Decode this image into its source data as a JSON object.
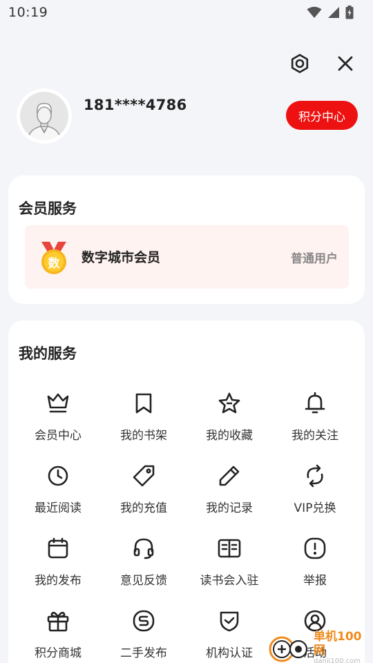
{
  "status_bar": {
    "time": "10:19"
  },
  "profile": {
    "phone": "181****4786",
    "points_button": "积分中心"
  },
  "member_card": {
    "title": "会员服务",
    "medal_char": "数",
    "membership_name": "数字城市会员",
    "membership_level": "普通用户"
  },
  "services_card": {
    "title": "我的服务",
    "items": [
      {
        "label": "会员中心",
        "icon": "crown-icon"
      },
      {
        "label": "我的书架",
        "icon": "bookmark-icon"
      },
      {
        "label": "我的收藏",
        "icon": "star-icon"
      },
      {
        "label": "我的关注",
        "icon": "bell-icon"
      },
      {
        "label": "最近阅读",
        "icon": "clock-icon"
      },
      {
        "label": "我的充值",
        "icon": "tag-icon"
      },
      {
        "label": "我的记录",
        "icon": "pencil-icon"
      },
      {
        "label": "VIP兑换",
        "icon": "exchange-icon"
      },
      {
        "label": "我的发布",
        "icon": "calendar-icon"
      },
      {
        "label": "意见反馈",
        "icon": "headset-icon"
      },
      {
        "label": "读书会入驻",
        "icon": "book-open-icon"
      },
      {
        "label": "举报",
        "icon": "alert-icon"
      },
      {
        "label": "积分商城",
        "icon": "gift-icon"
      },
      {
        "label": "二手发布",
        "icon": "resale-icon"
      },
      {
        "label": "机构认证",
        "icon": "shield-check-icon"
      },
      {
        "label": "活动",
        "icon": "user-circle-icon"
      }
    ]
  },
  "watermark": {
    "title": "单机100网",
    "url": "danji100.com"
  },
  "colors": {
    "accent": "#ee1111",
    "member_bg": "#fff3f1",
    "page_bg": "#f4f5f9",
    "watermark": "#f08a1c"
  }
}
